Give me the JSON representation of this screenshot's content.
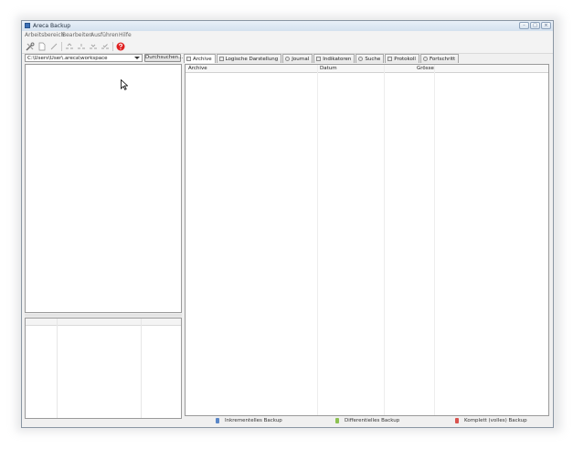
{
  "window": {
    "title": "Areca Backup",
    "controls": {
      "minimize": "–",
      "maximize": "□",
      "close": "×"
    }
  },
  "menu": {
    "items": [
      "Arbeitsbereich",
      "Bearbeiten",
      "Ausführen",
      "Hilfe"
    ]
  },
  "toolbar": {
    "icons": [
      "tools-icon",
      "new-document-icon",
      "edit-icon",
      "backup-icon",
      "merge-icon",
      "restore-icon",
      "check-icon",
      "help-icon"
    ]
  },
  "workspace": {
    "path": "C:\\Users\\User\\.areca\\workspace",
    "browse_label": "Durchsuchen..."
  },
  "tabs": [
    {
      "label": "Archive"
    },
    {
      "label": "Logische Darstellung"
    },
    {
      "label": "Journal"
    },
    {
      "label": "Indikatoren"
    },
    {
      "label": "Suche"
    },
    {
      "label": "Protokoll"
    },
    {
      "label": "Fortschritt"
    }
  ],
  "archive_table": {
    "columns": [
      "Archive",
      "Datum",
      "Grösse"
    ]
  },
  "legend": {
    "items": [
      {
        "label": "Inkrementelles Backup",
        "color": "#5a87c8"
      },
      {
        "label": "Differentielles Backup",
        "color": "#8cc152"
      },
      {
        "label": "Komplett (volles) Backup",
        "color": "#d9534f"
      }
    ]
  },
  "colors": {
    "accent": "#3d6fb5",
    "help_red": "#e02020"
  }
}
